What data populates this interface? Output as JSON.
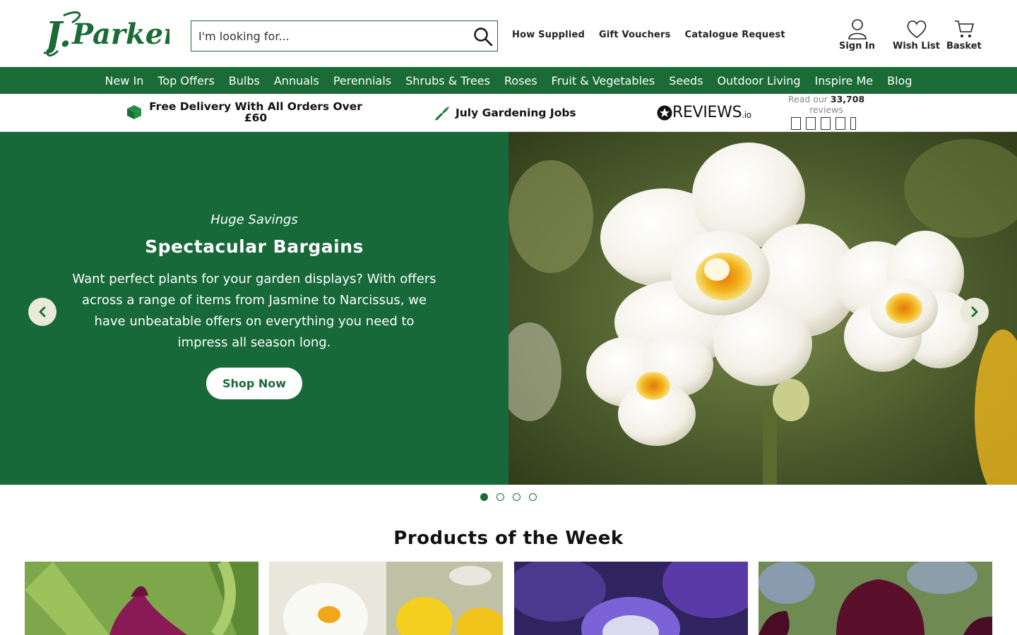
{
  "brand": {
    "name": "J.Parker's",
    "color": "#1a6b35"
  },
  "search": {
    "placeholder": "I'm looking for..."
  },
  "header_links": [
    "How Supplied",
    "Gift Vouchers",
    "Catalogue Request"
  ],
  "account": {
    "sign_in": "Sign In",
    "wish_list": "Wish List",
    "basket": "Basket"
  },
  "nav": [
    "New In",
    "Top Offers",
    "Bulbs",
    "Annuals",
    "Perennials",
    "Shrubs & Trees",
    "Roses",
    "Fruit & Vegetables",
    "Seeds",
    "Outdoor Living",
    "Inspire Me",
    "Blog"
  ],
  "usp": {
    "delivery": "Free Delivery With All Orders Over £60",
    "jobs": "July Gardening Jobs",
    "reviews_brand": "REVIEWS",
    "reviews_suffix": ".io",
    "reviews_prefix": "Read our",
    "reviews_count": "33,708",
    "reviews_word": "reviews"
  },
  "hero": {
    "kicker": "Huge Savings",
    "title": "Spectacular Bargains",
    "body": "Want perfect plants for your garden displays? With offers across a range of items from Jasmine to Narcissus, we have unbeatable offers on everything you need to impress all season long.",
    "cta": "Shop Now",
    "slides": 4,
    "active_slide": 1
  },
  "products_section": {
    "title": "Products of the Week"
  }
}
